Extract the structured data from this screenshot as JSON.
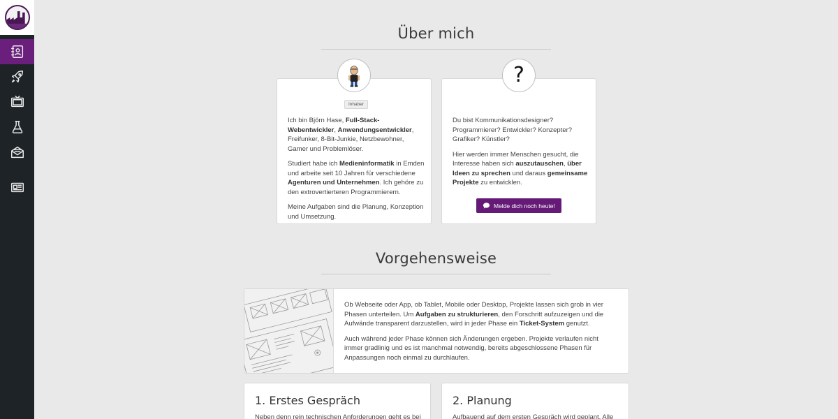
{
  "sidebar": {
    "items": [
      {
        "name": "sidebar-item-about",
        "icon": "contact-book-icon",
        "active": true
      },
      {
        "name": "sidebar-item-projects",
        "icon": "rocket-icon"
      },
      {
        "name": "sidebar-item-media",
        "icon": "tv-icon"
      },
      {
        "name": "sidebar-item-lab",
        "icon": "flask-icon"
      },
      {
        "name": "sidebar-item-contact",
        "icon": "envelope-icon"
      },
      {
        "name": "sidebar-item-news",
        "icon": "newspaper-icon"
      }
    ],
    "accent": "#6b1f7c",
    "background": "#1e2327"
  },
  "about": {
    "title": "Über mich",
    "owner_card": {
      "badge": "Inhaber",
      "p1": {
        "t1": "Ich bin Björn Hase, ",
        "b1": "Full-Stack-Webentwickler",
        "t2": ", ",
        "b2": "Anwendungsentwickler",
        "t3": ", Freifunker, 8-Bit-Junkie, Netzbewohner, Gamer und Problemlöser."
      },
      "p2": {
        "t1": "Studiert habe ich ",
        "b1": "Medieninformatik",
        "t2": " in Emden und arbeite seit 10 Jahren für verschiedene ",
        "b2": "Agenturen und Unternehmen",
        "t3": ". Ich gehöre zu den extrovertierteren Programmierern."
      },
      "p3": "Meine Aufgaben sind die Planung, Konzeption und Umsetzung."
    },
    "join_card": {
      "symbol": "?",
      "p1": "Du bist Kommunikationsdesigner? Programmierer? Entwickler? Konzepter? Grafiker? Künstler?",
      "p2": {
        "t1": "Hier werden immer Menschen gesucht, die Interesse haben sich ",
        "b1": "auszutauschen",
        "t2": ", ",
        "b2": "über Ideen zu sprechen",
        "t3": " und daraus ",
        "b3": "gemeinsame Projekte",
        "t4": " zu entwicklen."
      },
      "button": "Melde dich noch heute!"
    }
  },
  "approach": {
    "title": "Vorgehensweise",
    "intro": {
      "p1": {
        "t1": "Ob Webseite oder App, ob Tablet, Mobile oder Desktop, Projekte lassen sich grob in vier Phasen unterteilen. Um ",
        "b1": "Aufgaben zu strukturieren",
        "t2": ", den Forschritt aufzuzeigen und die Aufwände transparent darzustellen, wird in jeder Phase ein ",
        "b2": "Ticket-System",
        "t3": " genutzt."
      },
      "p2": "Auch während jeder Phase können sich Änderungen ergeben. Projekte verlaufen nicht immer gradlinig und es ist manchmal notwendig, bereits abgeschlossene Phasen für Anpassungen noch einmal zu durchlaufen."
    },
    "phases": [
      {
        "title": "1. Erstes Gespräch",
        "text": "Neben denn rein technischen Anforderungen geht es bei der"
      },
      {
        "title": "2. Planung",
        "text": "Aufbauend auf dem ersten Gespräch wird geplant. Alle"
      }
    ]
  }
}
